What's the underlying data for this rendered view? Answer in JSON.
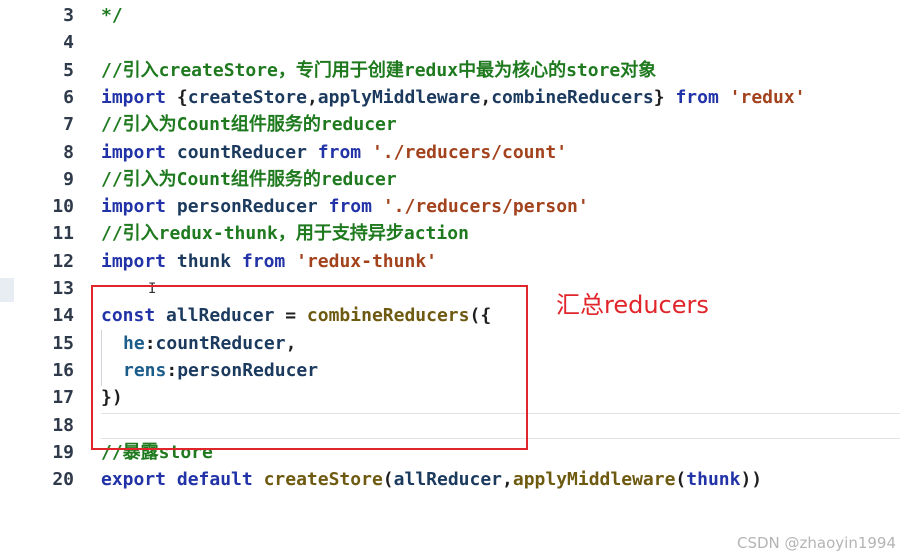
{
  "editor": {
    "lines": [
      {
        "number": "3",
        "tokens": [
          {
            "text": "*/",
            "cls": "cm"
          }
        ]
      },
      {
        "number": "4",
        "tokens": []
      },
      {
        "number": "5",
        "tokens": [
          {
            "text": "//引入createStore，专门用于创建redux中最为核心的store对象",
            "cls": "cm"
          }
        ]
      },
      {
        "number": "6",
        "tokens": [
          {
            "text": "import",
            "cls": "kw"
          },
          {
            "text": " ",
            "cls": "sp"
          },
          {
            "text": "{",
            "cls": "pl"
          },
          {
            "text": "createStore",
            "cls": "var"
          },
          {
            "text": ",",
            "cls": "pl"
          },
          {
            "text": "applyMiddleware",
            "cls": "var"
          },
          {
            "text": ",",
            "cls": "pl"
          },
          {
            "text": "combineReducers",
            "cls": "var"
          },
          {
            "text": "}",
            "cls": "pl"
          },
          {
            "text": " ",
            "cls": "sp"
          },
          {
            "text": "from",
            "cls": "kw"
          },
          {
            "text": " ",
            "cls": "sp"
          },
          {
            "text": "'redux'",
            "cls": "str"
          }
        ]
      },
      {
        "number": "7",
        "tokens": [
          {
            "text": "//引入为Count组件服务的reducer",
            "cls": "cm"
          }
        ]
      },
      {
        "number": "8",
        "tokens": [
          {
            "text": "import",
            "cls": "kw"
          },
          {
            "text": " ",
            "cls": "sp"
          },
          {
            "text": "countReducer",
            "cls": "var"
          },
          {
            "text": " ",
            "cls": "sp"
          },
          {
            "text": "from",
            "cls": "kw"
          },
          {
            "text": " ",
            "cls": "sp"
          },
          {
            "text": "'./reducers/count'",
            "cls": "str"
          }
        ]
      },
      {
        "number": "9",
        "tokens": [
          {
            "text": "//引入为Count组件服务的reducer",
            "cls": "cm"
          }
        ]
      },
      {
        "number": "10",
        "tokens": [
          {
            "text": "import",
            "cls": "kw"
          },
          {
            "text": " ",
            "cls": "sp"
          },
          {
            "text": "personReducer",
            "cls": "var"
          },
          {
            "text": " ",
            "cls": "sp"
          },
          {
            "text": "from",
            "cls": "kw"
          },
          {
            "text": " ",
            "cls": "sp"
          },
          {
            "text": "'./reducers/person'",
            "cls": "str"
          }
        ]
      },
      {
        "number": "11",
        "tokens": [
          {
            "text": "//引入redux-thunk，用于支持异步action",
            "cls": "cm"
          }
        ]
      },
      {
        "number": "12",
        "tokens": [
          {
            "text": "import",
            "cls": "kw"
          },
          {
            "text": " ",
            "cls": "sp"
          },
          {
            "text": "thunk",
            "cls": "var"
          },
          {
            "text": " ",
            "cls": "sp"
          },
          {
            "text": "from",
            "cls": "kw"
          },
          {
            "text": " ",
            "cls": "sp"
          },
          {
            "text": "'redux-thunk'",
            "cls": "str"
          }
        ]
      },
      {
        "number": "13",
        "tokens": []
      },
      {
        "number": "14",
        "tokens": [
          {
            "text": "const",
            "cls": "kw"
          },
          {
            "text": " ",
            "cls": "sp"
          },
          {
            "text": "allReducer",
            "cls": "var"
          },
          {
            "text": " = ",
            "cls": "pl"
          },
          {
            "text": "combineReducers",
            "cls": "fn"
          },
          {
            "text": "({",
            "cls": "pl"
          }
        ]
      },
      {
        "number": "15",
        "indent": true,
        "tokens": [
          {
            "text": "he",
            "cls": "prop"
          },
          {
            "text": ":",
            "cls": "pl"
          },
          {
            "text": "countReducer",
            "cls": "var"
          },
          {
            "text": ",",
            "cls": "pl"
          }
        ]
      },
      {
        "number": "16",
        "indent": true,
        "tokens": [
          {
            "text": "rens",
            "cls": "prop"
          },
          {
            "text": ":",
            "cls": "pl"
          },
          {
            "text": "personReducer",
            "cls": "var"
          }
        ]
      },
      {
        "number": "17",
        "tokens": [
          {
            "text": "})",
            "cls": "pl"
          }
        ]
      },
      {
        "number": "18",
        "tokens": []
      },
      {
        "number": "19",
        "tokens": [
          {
            "text": "//暴露store",
            "cls": "cm"
          }
        ]
      },
      {
        "number": "20",
        "tokens": [
          {
            "text": "export",
            "cls": "kw"
          },
          {
            "text": " ",
            "cls": "sp"
          },
          {
            "text": "default",
            "cls": "kw"
          },
          {
            "text": " ",
            "cls": "sp"
          },
          {
            "text": "createStore",
            "cls": "fn"
          },
          {
            "text": "(",
            "cls": "pl"
          },
          {
            "text": "allReducer",
            "cls": "var"
          },
          {
            "text": ",",
            "cls": "pl"
          },
          {
            "text": "applyMiddleware",
            "cls": "fn"
          },
          {
            "text": "(",
            "cls": "pl"
          },
          {
            "text": "thunk",
            "cls": "kw"
          },
          {
            "text": "))",
            "cls": "pl"
          }
        ]
      }
    ]
  },
  "annotation": {
    "text": "汇总reducers",
    "color": "#e0252b"
  },
  "watermark": {
    "text": "CSDN @zhaoyin1994"
  },
  "colors": {
    "keyword": "#2233a8",
    "function": "#6e5a10",
    "variable": "#1b3a5e",
    "property": "#1a5c8a",
    "string": "#a3431d",
    "comment": "#1f7a1f",
    "line_number": "#2f3a4a"
  }
}
